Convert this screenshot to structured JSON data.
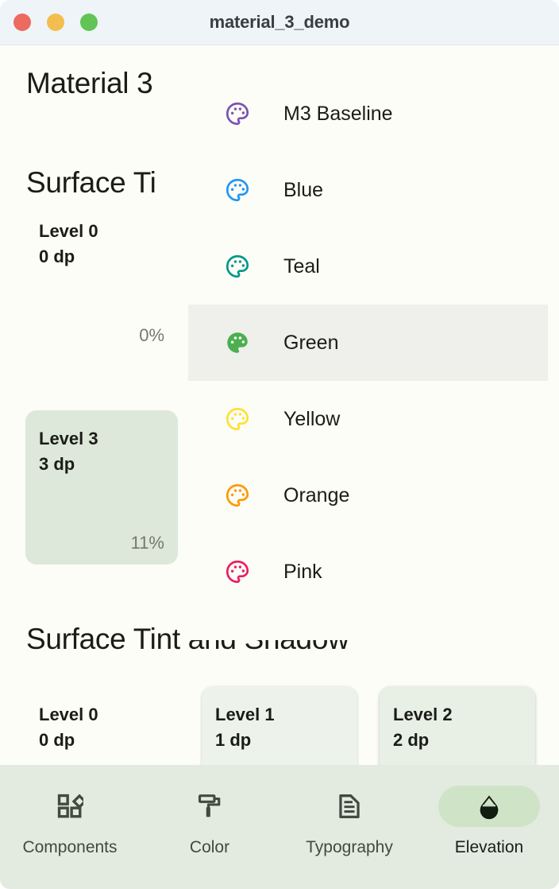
{
  "window": {
    "title": "material_3_demo",
    "traffic_lights": [
      {
        "name": "close",
        "color": "#EC6A5E"
      },
      {
        "name": "minimize",
        "color": "#F4BD4F"
      },
      {
        "name": "maximize",
        "color": "#61C455"
      }
    ]
  },
  "headings": {
    "app_title": "Material 3",
    "surface_tint": "Surface Ti",
    "surface_tint_and_shadow": "Surface Tint and Shadow"
  },
  "surface_tint_cards": [
    {
      "level": "Level 0",
      "dp": "0 dp",
      "percent": "0%",
      "tint": "transparent"
    },
    {
      "level": "Level 3",
      "dp": "3 dp",
      "percent": "11%",
      "tint": "#DDE8DA"
    }
  ],
  "surface_tint_shadow_cards": [
    {
      "level": "Level 0",
      "dp": "0 dp",
      "tint": "transparent"
    },
    {
      "level": "Level 1",
      "dp": "1 dp",
      "tint": "#EDF2EA"
    },
    {
      "level": "Level 2",
      "dp": "2 dp",
      "tint": "#E8EFE5"
    }
  ],
  "theme_menu": {
    "selected": "Green",
    "items": [
      {
        "label": "M3 Baseline",
        "icon": "palette-icon",
        "color": "#7A52B3",
        "filled": false
      },
      {
        "label": "Blue",
        "icon": "palette-icon",
        "color": "#2196F3",
        "filled": false
      },
      {
        "label": "Teal",
        "icon": "palette-icon",
        "color": "#009688",
        "filled": false
      },
      {
        "label": "Green",
        "icon": "palette-icon",
        "color": "#4CAF50",
        "filled": true
      },
      {
        "label": "Yellow",
        "icon": "palette-icon",
        "color": "#FFE033",
        "filled": false
      },
      {
        "label": "Orange",
        "icon": "palette-icon",
        "color": "#FF9800",
        "filled": false
      },
      {
        "label": "Pink",
        "icon": "palette-icon",
        "color": "#E91E63",
        "filled": false
      }
    ]
  },
  "bottom_nav": {
    "active": "Elevation",
    "items": [
      {
        "label": "Components",
        "icon": "components-grid-icon"
      },
      {
        "label": "Color",
        "icon": "paint-roller-icon"
      },
      {
        "label": "Typography",
        "icon": "document-text-icon"
      },
      {
        "label": "Elevation",
        "icon": "water-drop-icon"
      }
    ]
  },
  "colors": {
    "surface": "#FCFDF6",
    "titlebar": "#EFF4F8",
    "nav_background": "#E3EBE1",
    "nav_active_pill": "#CFE4C7",
    "menu_highlight": "#EFEFEC",
    "on_surface": "#1B1C18",
    "on_surface_variant": "#74796D"
  }
}
